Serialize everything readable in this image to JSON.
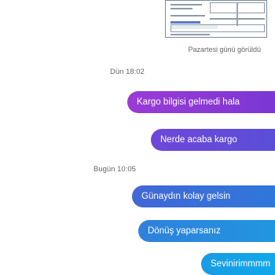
{
  "chat": {
    "seen_status": "Pazartesi günü görüldü",
    "groups": [
      {
        "date": "Dün 18:02",
        "messages": [
          "Kargo bilgisi gelmedi hala",
          "Nerde acaba kargo"
        ]
      },
      {
        "date": "Bugün 10:05",
        "messages": [
          "Günaydın kolay gelsin",
          "Dönüş yaparsanız",
          "Sevinirimmmm"
        ]
      }
    ]
  },
  "colors": {
    "bubble_gradient_top": "#9b3bd6",
    "bubble_gradient_bottom": "#10a8e8",
    "meta_text": "#666666"
  }
}
